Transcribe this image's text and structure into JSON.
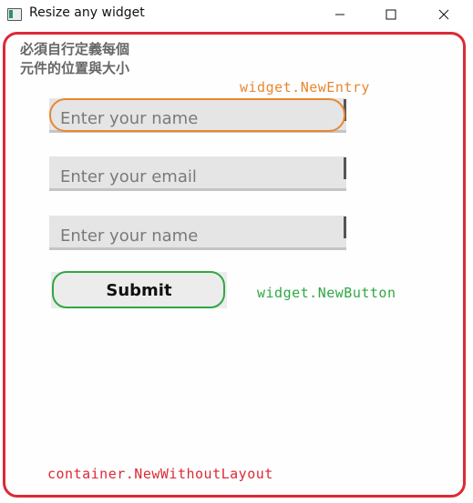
{
  "window": {
    "title": "Resize any widget",
    "app_icon": "app-window-icon",
    "controls": [
      "minimize-icon",
      "maximize-icon",
      "close-icon"
    ]
  },
  "note": "必須自行定義每個\n元件的位置與大小",
  "annotations": {
    "entry": "widget.NewEntry",
    "button": "widget.NewButton",
    "container": "container.NewWithoutLayout"
  },
  "form": {
    "entries": [
      {
        "placeholder": "Enter your name",
        "value": ""
      },
      {
        "placeholder": "Enter your email",
        "value": ""
      },
      {
        "placeholder": "Enter your name",
        "value": ""
      }
    ],
    "submit_label": "Submit"
  },
  "colors": {
    "container_outline": "#dc2a36",
    "entry_outline": "#e88730",
    "button_outline": "#2fa844"
  }
}
